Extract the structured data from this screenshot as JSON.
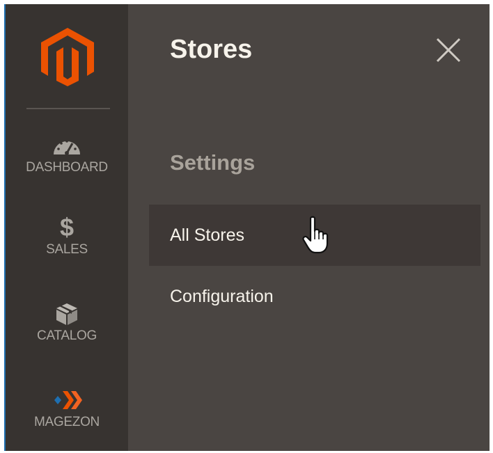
{
  "sidebar": {
    "logo_icon": "magento-logo-icon",
    "items": [
      {
        "label": "DASHBOARD",
        "icon": "speedometer-icon"
      },
      {
        "label": "SALES",
        "icon": "dollar-icon",
        "glyph": "$"
      },
      {
        "label": "CATALOG",
        "icon": "box-icon"
      },
      {
        "label": "MAGEZON",
        "icon": "magezon-logo-icon"
      }
    ],
    "accent_color": "#1e6fb0"
  },
  "panel": {
    "title": "Stores",
    "close_icon": "close-icon",
    "section_title": "Settings",
    "items": [
      {
        "label": "All Stores",
        "state": "hovered"
      },
      {
        "label": "Configuration"
      }
    ]
  },
  "colors": {
    "sidebar_bg": "#373330",
    "panel_bg": "#4a4542",
    "hover_bg": "#3e3836",
    "brand_orange": "#eb5202"
  }
}
